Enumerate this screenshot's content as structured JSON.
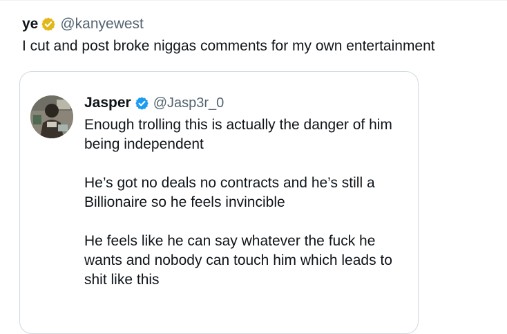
{
  "tweet": {
    "display_name": "ye",
    "handle": "@kanyewest",
    "text": "I cut and post broke niggas comments for my own entertainment",
    "badge_icon": "gold-verified-badge"
  },
  "quote": {
    "display_name": "Jasper",
    "handle": "@Jasp3r_0",
    "badge_icon": "blue-verified-badge",
    "paragraphs": [
      [
        "Enough trolling this is actually the danger of him",
        "being independent"
      ],
      [
        "He’s got no deals no contracts and he’s still a",
        "Billionaire so he feels invincible"
      ],
      [
        "He feels like he can say whatever the fuck he",
        "wants and nobody can touch him which leads to",
        "shit like this"
      ]
    ]
  },
  "colors": {
    "gold_badge": "#e2b719",
    "blue_badge": "#1d9bf0",
    "handle_gray": "#536471",
    "border": "#cfd9de"
  }
}
